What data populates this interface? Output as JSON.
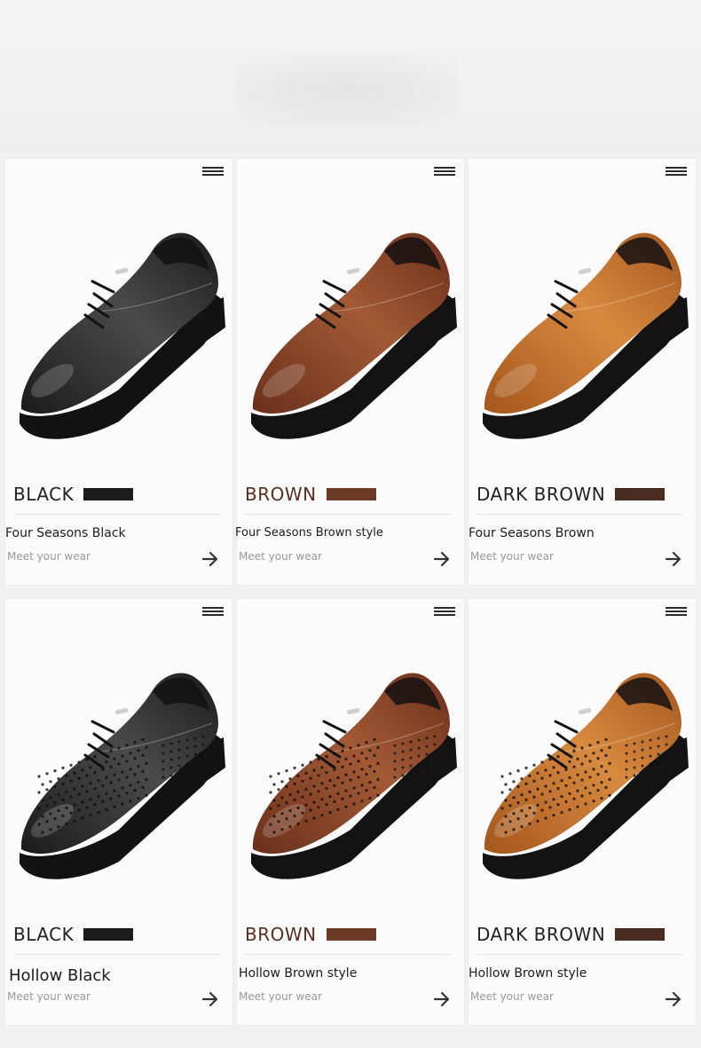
{
  "products": [
    {
      "color_name": "BLACK",
      "color_name_color": "#222222",
      "swatch": "#1e1c1b",
      "title": "Four Seasons Black",
      "subtitle": "Meet your wear",
      "shoe": {
        "upper": "#1b1b1b",
        "upper_light": "#4a4a4a",
        "sole": "#121212",
        "hollow": false
      }
    },
    {
      "color_name": "BROWN",
      "color_name_color": "#5a2d1d",
      "swatch": "#6b3a24",
      "title": "Four Seasons Brown style",
      "subtitle": "Meet your wear",
      "shoe": {
        "upper": "#6a2f1b",
        "upper_light": "#a25a35",
        "sole": "#141212",
        "hollow": false
      }
    },
    {
      "color_name": "DARK BROWN",
      "color_name_color": "#222222",
      "swatch": "#4a2b20",
      "title": "Four Seasons Brown",
      "subtitle": "Meet your wear",
      "shoe": {
        "upper": "#a4561d",
        "upper_light": "#d88a3f",
        "sole": "#141212",
        "hollow": false
      }
    },
    {
      "color_name": "BLACK",
      "color_name_color": "#222222",
      "swatch": "#1e1c1b",
      "title": "Hollow Black",
      "subtitle": "Meet your wear",
      "shoe": {
        "upper": "#1b1b1b",
        "upper_light": "#4a4a4a",
        "sole": "#121212",
        "hollow": true
      }
    },
    {
      "color_name": "BROWN",
      "color_name_color": "#5a2d1d",
      "swatch": "#6b3a24",
      "title": "Hollow Brown style",
      "subtitle": "Meet your wear",
      "shoe": {
        "upper": "#6a2f1b",
        "upper_light": "#a25a35",
        "sole": "#141212",
        "hollow": true
      }
    },
    {
      "color_name": "DARK BROWN",
      "color_name_color": "#222222",
      "swatch": "#4a2b20",
      "title": "Hollow Brown style",
      "subtitle": "Meet your wear",
      "shoe": {
        "upper": "#a4561d",
        "upper_light": "#d88a3f",
        "sole": "#141212",
        "hollow": true
      }
    }
  ],
  "icons": {
    "menu": "menu-icon",
    "arrow": "arrow-right-icon"
  }
}
